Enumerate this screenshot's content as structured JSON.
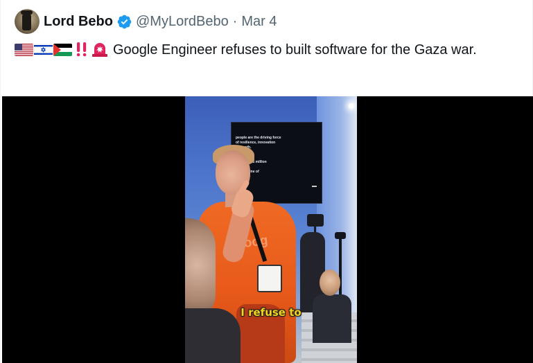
{
  "post": {
    "author": {
      "display_name": "Lord Bebo",
      "handle": "@MyLordBebo",
      "verified": true,
      "separator": "·",
      "date": "Mar 4"
    },
    "prefix_icons": [
      "us-flag-icon",
      "israel-flag-icon",
      "palestine-flag-icon",
      "double-exclamation-icon",
      "siren-icon"
    ],
    "text": "Google Engineer refuses to built software for the Gaza war.",
    "media": {
      "type": "video",
      "caption": "I refuse to",
      "shirt_text": "Goog",
      "screen_text": "people are the driving force\nof resilience, innovation\nd growth.\n\n22.\nvesting $25 million\nrs in\ng a pipeline of\nlented —"
    }
  },
  "colors": {
    "text_primary": "#0f1419",
    "text_secondary": "#536471",
    "verified_blue": "#1d9bf0",
    "alert_red": "#e0245e",
    "caption_yellow": "#f6d31f"
  }
}
